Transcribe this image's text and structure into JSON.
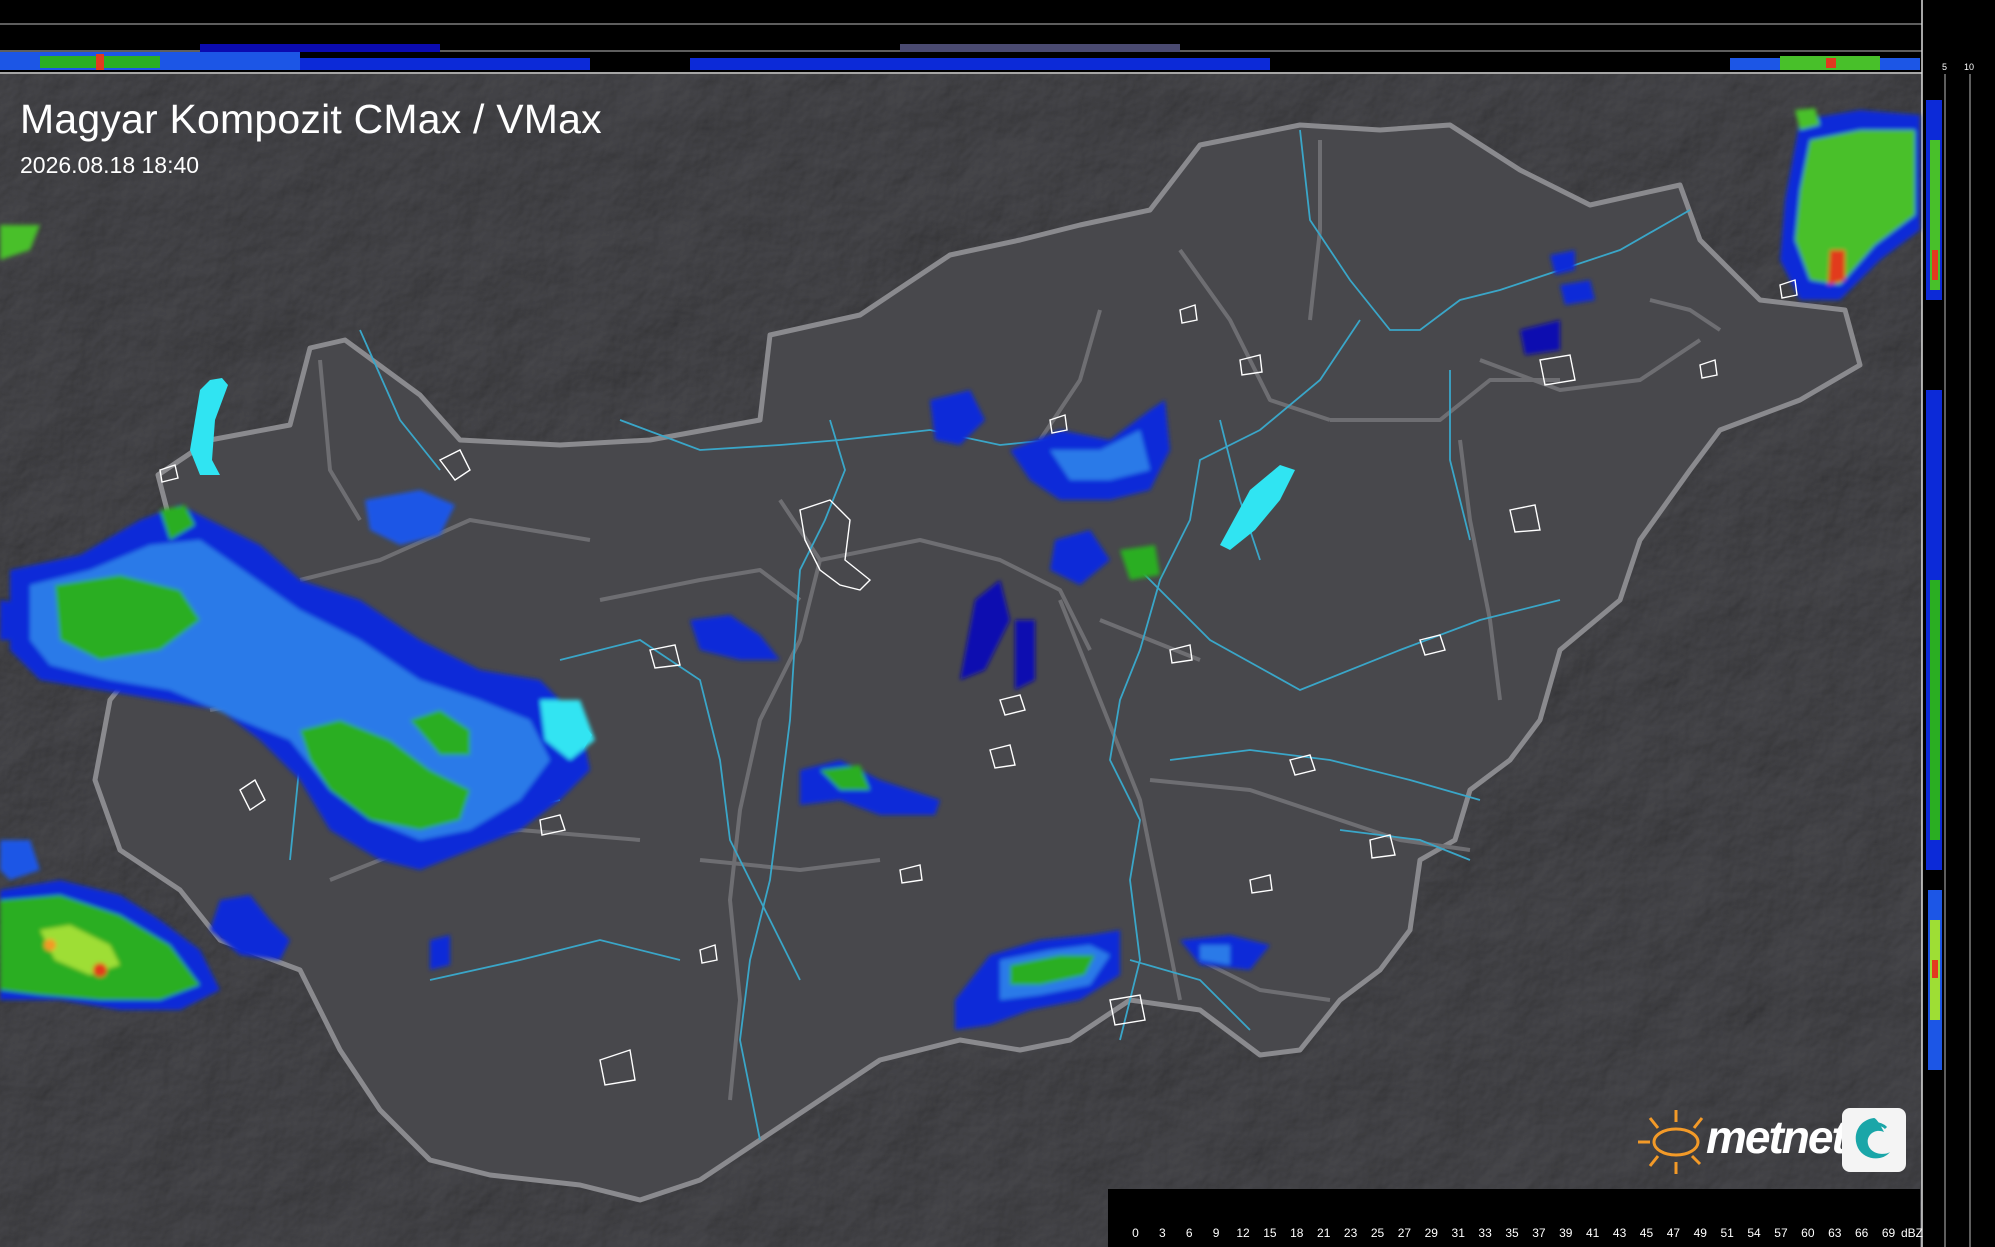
{
  "map": {
    "title": "Magyar Kompozit CMax / VMax",
    "timestamp": "2026.08.18 18:40",
    "brand": "metnet",
    "top_profile_ticks": [
      "10",
      "5"
    ],
    "side_profile_ticks": [
      "5",
      "10"
    ]
  },
  "legend": {
    "unit": "dBZ",
    "ticks": [
      "0",
      "3",
      "6",
      "9",
      "12",
      "15",
      "18",
      "21",
      "23",
      "25",
      "27",
      "29",
      "31",
      "33",
      "35",
      "37",
      "39",
      "41",
      "43",
      "45",
      "47",
      "49",
      "51",
      "54",
      "57",
      "60",
      "63",
      "66",
      "69"
    ],
    "colors": [
      "#0a0a7a",
      "#0b0bb0",
      "#0c2ad8",
      "#1c56e6",
      "#2b7ae8",
      "#3da8ee",
      "#0d5a12",
      "#0e6e15",
      "#127f18",
      "#179a1c",
      "#2aae22",
      "#48c02a",
      "#70cf2e",
      "#9ede34",
      "#c7ea38",
      "#f0e83a",
      "#f4c230",
      "#f39a28",
      "#f06a22",
      "#e23a1e",
      "#c8141a",
      "#b00c14",
      "#900810",
      "#70060c",
      "#500408",
      "#d024d8",
      "#e876ea",
      "#f0a8f2",
      "#88f4f4"
    ]
  },
  "colors": {
    "country_fill": "#48484c",
    "country_border": "#8a8a8e",
    "rivers": "#3aa6c8",
    "lakes": "#30e4f2",
    "background": "#232325"
  }
}
